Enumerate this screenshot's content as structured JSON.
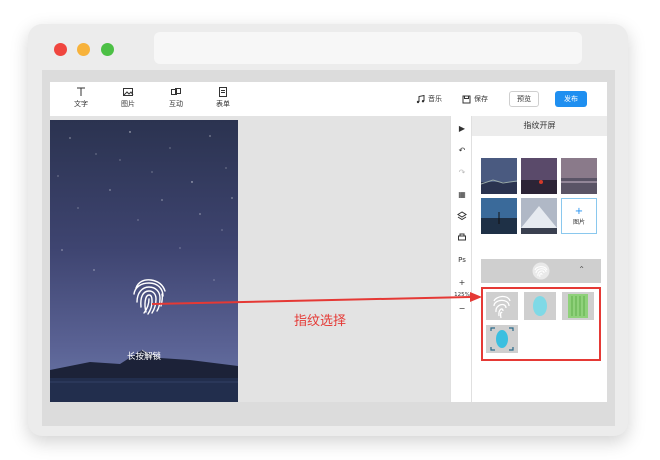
{
  "window": {
    "controls": [
      {
        "name": "close",
        "color": "#f0463f"
      },
      {
        "name": "minimize",
        "color": "#f7b23b"
      },
      {
        "name": "maximize",
        "color": "#4cc045"
      }
    ]
  },
  "toolbar": {
    "items": [
      {
        "label": "文字",
        "icon": "text-icon"
      },
      {
        "label": "图片",
        "icon": "image-icon"
      },
      {
        "label": "互动",
        "icon": "interaction-icon"
      },
      {
        "label": "表单",
        "icon": "form-icon"
      }
    ],
    "music_label": "音乐",
    "save_label": "保存",
    "preview_label": "预览",
    "publish_label": "发布"
  },
  "canvas": {
    "unlock_text": "长按解锁"
  },
  "side_tools": {
    "zoom": "125%"
  },
  "panel": {
    "title": "指纹开屏",
    "add_image_label": "图片"
  },
  "annotation": {
    "label": "指纹选择"
  },
  "colors": {
    "accent": "#1f8ff0",
    "annotation": "#e53935"
  }
}
